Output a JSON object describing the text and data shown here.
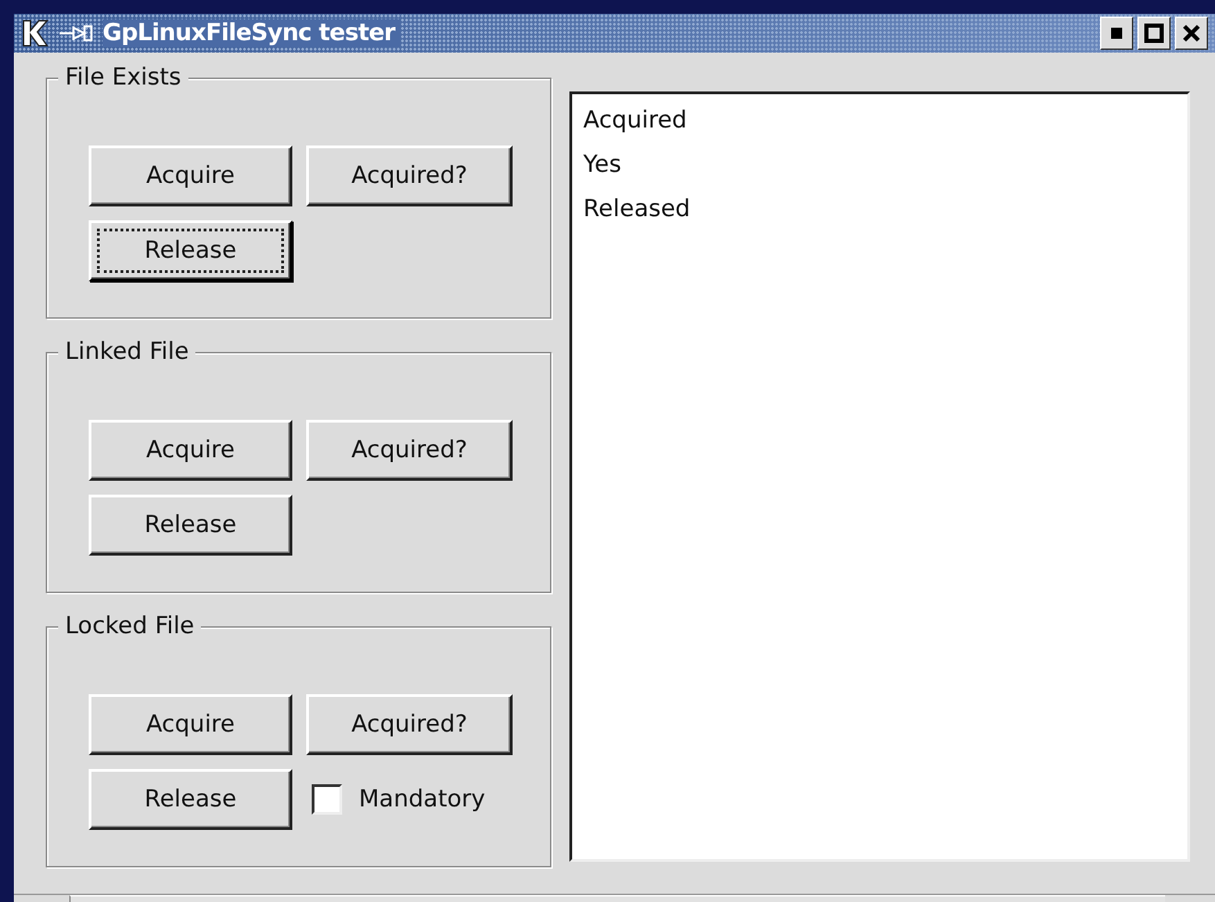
{
  "window": {
    "title": "GpLinuxFileSync tester"
  },
  "groups": [
    {
      "title": "File Exists",
      "buttons": [
        {
          "label": "Acquire",
          "focused": false
        },
        {
          "label": "Acquired?",
          "focused": false
        },
        {
          "label": "Release",
          "focused": true
        }
      ]
    },
    {
      "title": "Linked File",
      "buttons": [
        {
          "label": "Acquire",
          "focused": false
        },
        {
          "label": "Acquired?",
          "focused": false
        },
        {
          "label": "Release",
          "focused": false
        }
      ]
    },
    {
      "title": "Locked File",
      "buttons": [
        {
          "label": "Acquire",
          "focused": false
        },
        {
          "label": "Acquired?",
          "focused": false
        },
        {
          "label": "Release",
          "focused": false
        }
      ],
      "checkbox": {
        "label": "Mandatory",
        "checked": false
      }
    }
  ],
  "log": [
    "Acquired",
    "Yes",
    "Released"
  ]
}
